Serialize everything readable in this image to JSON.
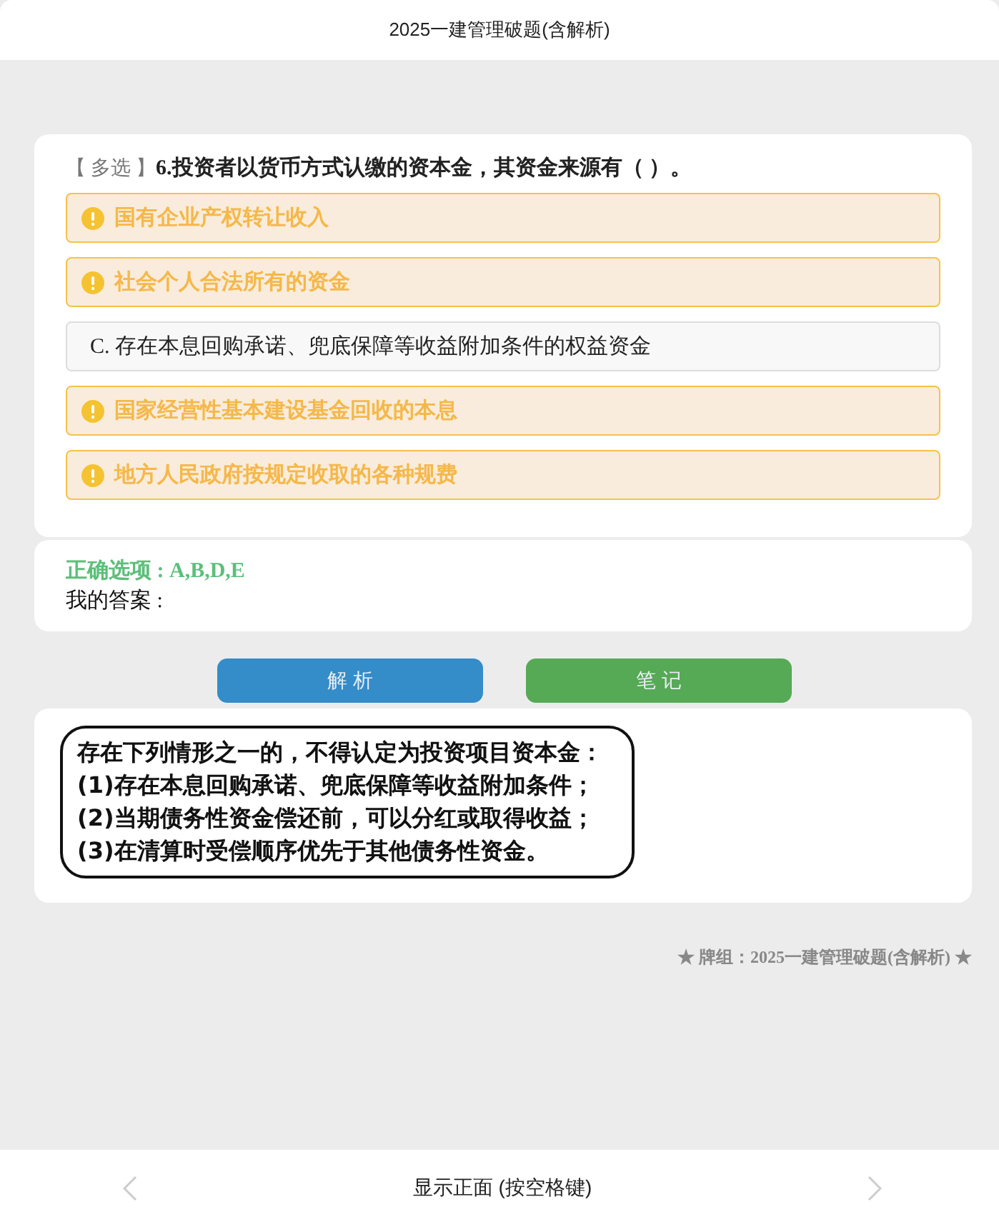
{
  "window": {
    "title": "2025一建管理破题(含解析)"
  },
  "question": {
    "type_tag": "【 多选 】",
    "text": "6.投资者以货币方式认缴的资本金，其资金来源有（ ）。"
  },
  "options": [
    {
      "kind": "flagged",
      "text": "国有企业产权转让收入"
    },
    {
      "kind": "flagged",
      "text": "社会个人合法所有的资金"
    },
    {
      "kind": "plain",
      "text": "C. 存在本息回购承诺、兜底保障等收益附加条件的权益资金"
    },
    {
      "kind": "flagged",
      "text": "国家经营性基本建设基金回收的本息"
    },
    {
      "kind": "flagged",
      "text": "地方人民政府按规定收取的各种规费"
    }
  ],
  "answer": {
    "correct": "正确选项 : A,B,D,E",
    "mine": "我的答案 :"
  },
  "buttons": [
    {
      "kind": "analysis",
      "label": "解 析"
    },
    {
      "kind": "notes",
      "label": "笔 记"
    }
  ],
  "explanation": {
    "lines": [
      "存在下列情形之一的，不得认定为投资项目资本金：",
      "(1)存在本息回购承诺、兜底保障等收益附加条件；",
      "(2)当期债务性资金偿还前，可以分红或取得收益；",
      "(3)在清算时受偿顺序优先于其他债务性资金。"
    ]
  },
  "deck": {
    "label": "★ 牌组：2025一建管理破题(含解析) ★"
  },
  "bottom_bar": {
    "label": "显示正面 (按空格键)"
  }
}
